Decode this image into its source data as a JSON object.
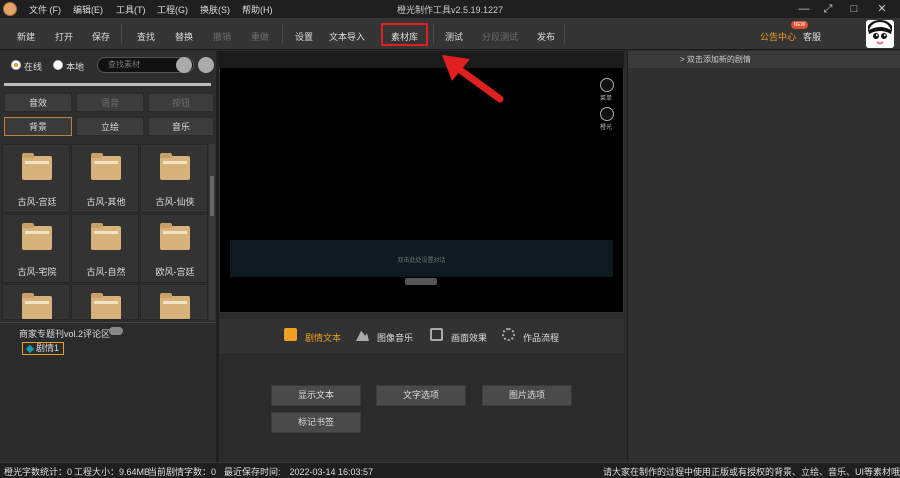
{
  "titlebar": {
    "title": "橙光制作工具v2.5.19.1227",
    "menus": [
      "文件 (F)",
      "编辑(E)",
      "工具(T)",
      "工程(G)",
      "换肤(S)",
      "帮助(H)"
    ],
    "controls": [
      "—",
      "⤢",
      "□",
      "✕"
    ]
  },
  "toolbar": {
    "new": "新建",
    "open": "打开",
    "save": "保存",
    "find": "查找",
    "replace": "替换",
    "undo": "撤销",
    "redo": "重做",
    "settings": "设置",
    "import_text": "文本导入",
    "material": "素材库",
    "test": "测试",
    "segment_test": "分段测试",
    "publish": "发布",
    "notice": "公告中心",
    "new_badge": "NEW",
    "service": "客服"
  },
  "left": {
    "radio_online": "在线",
    "radio_local": "本地",
    "search_placeholder": "查找素材",
    "categories": [
      "音效",
      "语音",
      "按钮",
      "背景",
      "立绘",
      "音乐"
    ],
    "tiles": [
      "古风-宫廷",
      "古风-其他",
      "古风-仙侠",
      "古风-宅院",
      "古风-自然",
      "欧风-宫廷",
      "",
      "",
      ""
    ]
  },
  "tree": {
    "root": "商家专题刊vol.2评论区",
    "child": "剧情1"
  },
  "preview": {
    "dialog_hint": "双击此处设置对话",
    "menu_label": "菜单",
    "orange_label": "橙光"
  },
  "tabs": [
    "剧情文本",
    "图像音乐",
    "画面效果",
    "作品流程"
  ],
  "actions": [
    "显示文本",
    "文字选项",
    "图片选项",
    "标记书签"
  ],
  "right": {
    "hint": "> 双击添加新的剧情"
  },
  "status": {
    "word_count": "橙光字数统计：0",
    "project_size": "工程大小：9.64MB",
    "current_words": "当前剧情字数：0",
    "last_save": "最近保存时间:　2022-03-14 16:03:57",
    "notice": "请大家在制作的过程中使用正版或有授权的背景、立绘、音乐、UI等素材哦~"
  },
  "colors": {
    "accent": "#f0a020",
    "highlight_border": "#e02020",
    "arrow": "#e02020"
  }
}
